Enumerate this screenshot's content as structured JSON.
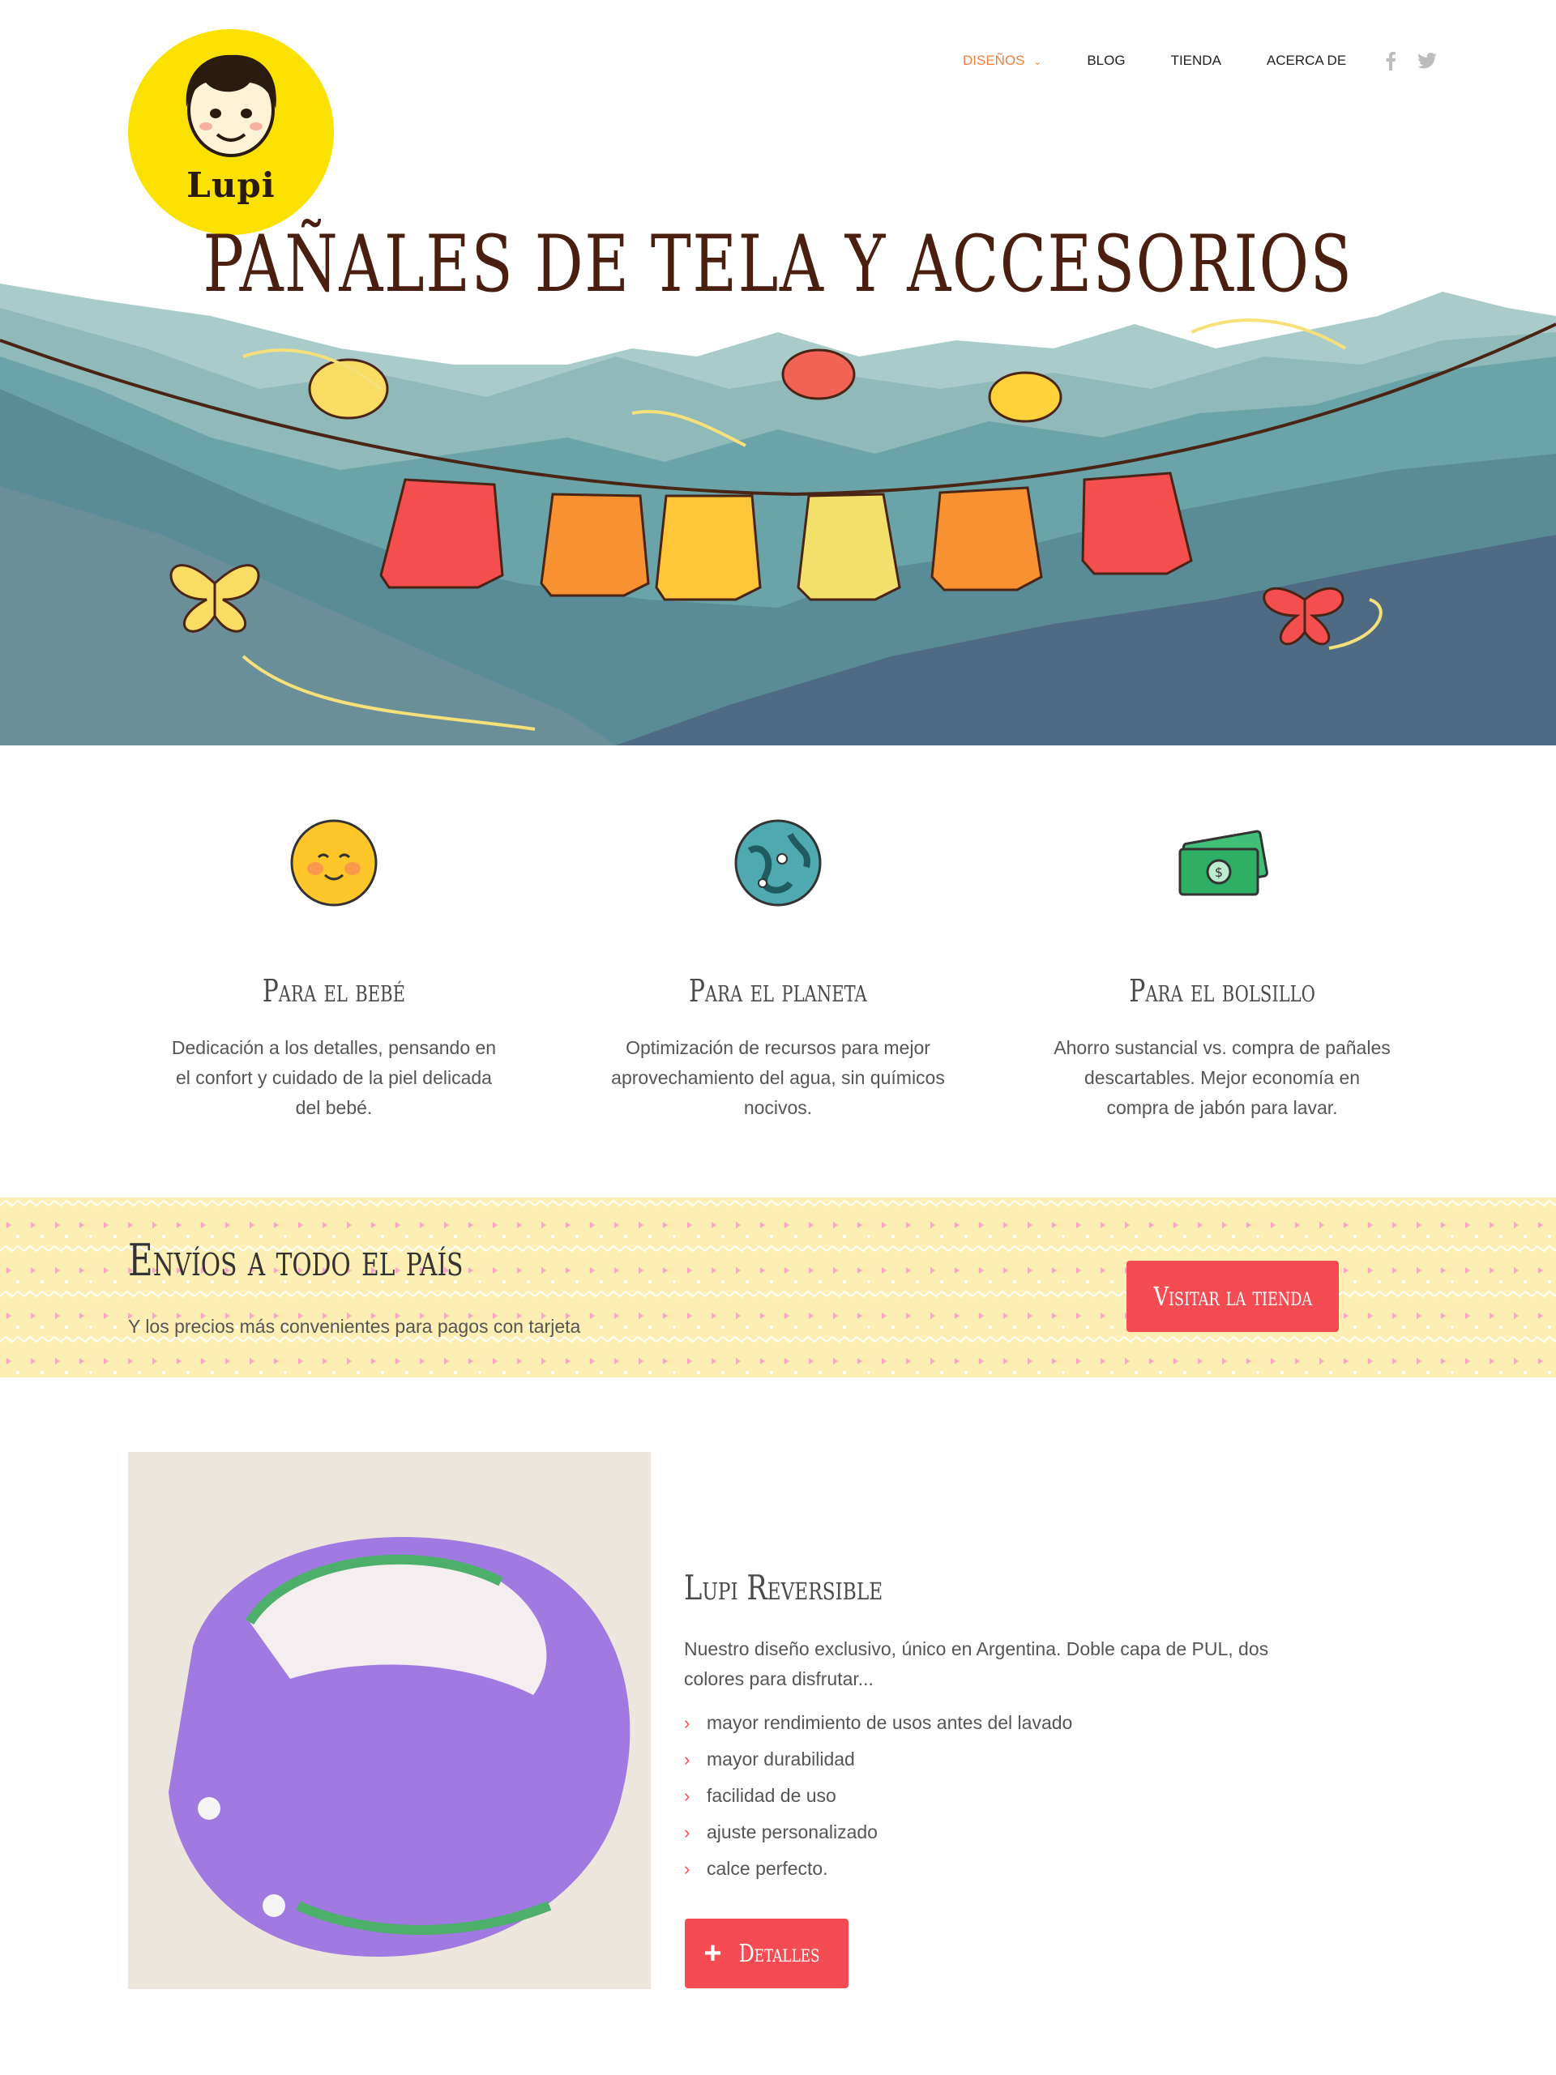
{
  "brand": {
    "name": "Lupi"
  },
  "nav": {
    "items": [
      {
        "label": "DISEÑOS",
        "active": true,
        "has_dropdown": true
      },
      {
        "label": "BLOG",
        "active": false
      },
      {
        "label": "TIENDA",
        "active": false
      },
      {
        "label": "ACERCA DE",
        "active": false
      }
    ],
    "social": [
      "facebook-icon",
      "twitter-icon"
    ],
    "active_color": "#f07f3c"
  },
  "hero": {
    "title": "PAÑALES DE TELA Y ACCESORIOS"
  },
  "features": [
    {
      "icon": "smiley-face-icon",
      "title": "Para el bebé",
      "text": "Dedicación a los detalles, pensando en el confort y cuidado de la piel delicada del bebé."
    },
    {
      "icon": "globe-icon",
      "title": "Para el planeta",
      "text": "Optimización de recursos para mejor aprovechamiento del agua, sin químicos nocivos."
    },
    {
      "icon": "money-icon",
      "title": "Para el bolsillo",
      "text": "Ahorro sustancial vs. compra de pañales descartables. Mejor economía en compra de jabón para lavar."
    }
  ],
  "banner": {
    "title": "Envíos a todo el país",
    "subtitle": "Y los precios más convenientes para pagos con tarjeta",
    "button": "Visitar la tienda"
  },
  "product": {
    "title": "Lupi Reversible",
    "description": "Nuestro diseño exclusivo, único en Argentina. Doble capa de PUL, dos colores para disfrutar...",
    "features": [
      "mayor rendimiento de usos antes del lavado",
      "mayor durabilidad",
      "facilidad de uso",
      "ajuste personalizado",
      "calce perfecto."
    ],
    "button": "Detalles"
  },
  "colors": {
    "accent": "#f54b52",
    "logo_yellow": "#fbe100",
    "banner_bg": "#fdeeb4"
  }
}
